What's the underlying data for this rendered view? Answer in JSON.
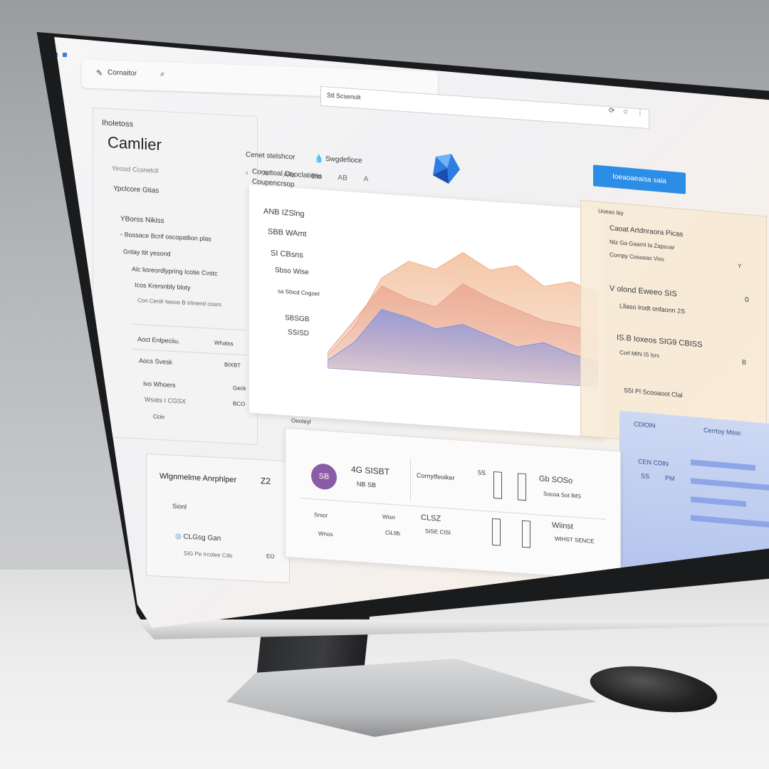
{
  "browser": {
    "tab_title": "Cornaitor",
    "address_text": "Stl Scsenolt"
  },
  "sidebar": {
    "section_label": "Iholetoss",
    "app_title": "Camlier",
    "subtitle": "Yircocl Ccsnelcil",
    "group_title": "Ypclcore Gtias",
    "items": [
      {
        "label": "YBorss  Nikiss"
      },
      {
        "label": "Bossace Bcrif oscopatlion plas"
      },
      {
        "label": "Gnlay ltit yesond"
      },
      {
        "label": "Alc lioreordlypring Icotie Cvstc"
      },
      {
        "label": "Icos Krersnbly bloty"
      },
      {
        "label": "Con Cerdr twoos B Irlinend cosrn"
      }
    ],
    "table": {
      "header": [
        "Aoct Enlpeciiu.",
        "Whatss"
      ],
      "rows": [
        [
          "Aocs Svesk",
          "BIXBT"
        ],
        [
          "Ivo Whoers",
          "Geck"
        ],
        [
          "Wsats I CGSX",
          "BCO"
        ],
        [
          "Ccin",
          ""
        ]
      ]
    },
    "card": {
      "title": "Wlgnmelme Anrphlper",
      "value": "Z2",
      "field": "Sionl",
      "option": "CLGsg Gan",
      "footer": "SiG Pe Ircolee Cdo",
      "footer_count": "EO"
    }
  },
  "header": {
    "breadcrumb_left": "Cenet stelshcor",
    "breadcrumb_right": "Swgdefioce",
    "icons_row": [
      "A",
      "ATo",
      "Blo",
      "AB",
      "A"
    ]
  },
  "primary_button": "Ioeaoaeaisa saia",
  "chart": {
    "title": "Conattoal Gooclations",
    "subtitle": "Coupencrsop",
    "labels": [
      "ANB IZSlng",
      "SBB WAmt",
      "SI CBsns",
      "Sbso Wise",
      "sa Sbicd Cogoet",
      "SBSGB",
      "SSISD"
    ]
  },
  "chart_data": {
    "type": "area",
    "series": [
      {
        "values": [
          5,
          18,
          40,
          36,
          30,
          34,
          28,
          22,
          26,
          20,
          16
        ]
      },
      {
        "values": [
          10,
          32,
          55,
          48,
          44,
          60,
          52,
          46,
          40,
          38,
          35
        ]
      },
      {
        "values": [
          8,
          28,
          60,
          72,
          68,
          80,
          70,
          74,
          62,
          66,
          60
        ]
      }
    ],
    "colors": [
      "#7f93e6",
      "#e9a28c",
      "#f0b48a"
    ]
  },
  "right": {
    "label": "Uoeas lay",
    "title": "Caoat Artdnraora Picas",
    "line1": "Ntz Ga Gaarnl Ia Zapzuar",
    "line2": "Cornpy Cosoeas Viss",
    "line2_num": "Y",
    "block_title": "V olond Eweeo SIS",
    "block_num": "0",
    "block_line": "Lllaso lrodt onfaonn 2S",
    "stat_title": "IS.B Ioxeos SIG9 CBISS",
    "stat_line": "Corl  MIN IS lsrs",
    "stat_num": "B",
    "footer": "S5I  Pl  Scooaoot Clal"
  },
  "blue": {
    "label_left": "CDlOlN",
    "label_right": "Cerrtoy Mssc",
    "row_label": "CEN CDlN",
    "row_values": [
      "SS",
      "PM"
    ],
    "bars": [
      0.7,
      0.85,
      0.6,
      0.9
    ]
  },
  "stats": {
    "label": "Oeoteyl",
    "badge": "SB",
    "value1": "4G SISBT",
    "value1_sub": "NB  SB",
    "col2_title": "Cornytfeoiker",
    "col2_num": "5S",
    "col3_value": "Gb SOSo",
    "col3_sub": "Socoa Sot lMS",
    "row2_left": "Srsor",
    "row2_left2": "Wisn",
    "row2_left_sub": "Wnos",
    "row2_mid": "CiL9b",
    "row2_val": "CLSZ",
    "row2_val_sub": "SISE CISI",
    "row2_right": "Wiinst",
    "row2_right_sub": "WIHST SENCE"
  }
}
